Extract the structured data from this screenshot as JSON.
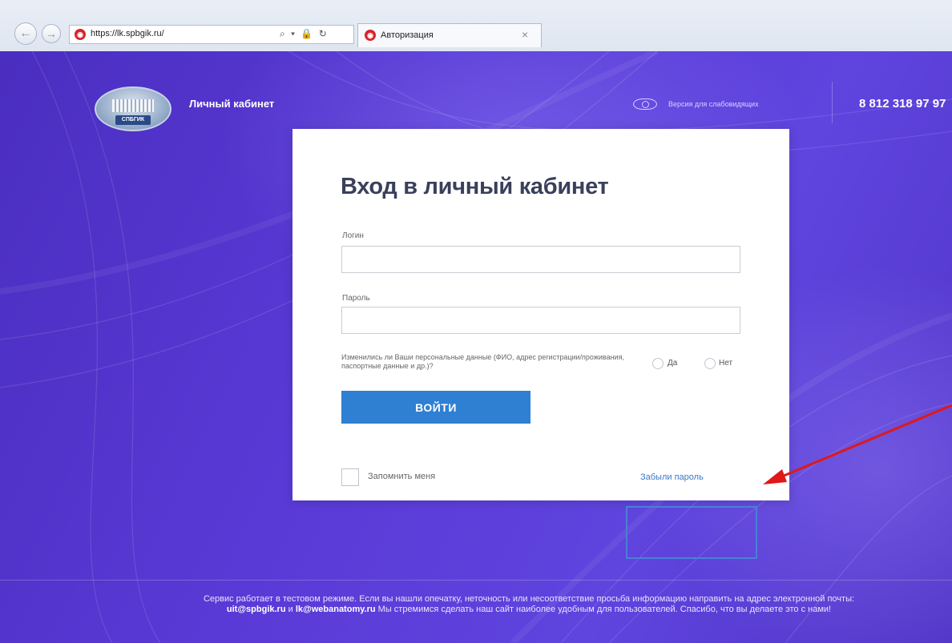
{
  "browser": {
    "url": "https://lk.spbgik.ru/",
    "address_icons": "⌕ ▾ 🔒 ↻",
    "tab_title": "Авторизация",
    "tab_close": "×",
    "back_glyph": "←",
    "forward_glyph": "→"
  },
  "header": {
    "logo_text": "СПБГИК",
    "site_title": "Личный кабинет",
    "vision_link": "Версия для слабовидящих",
    "phone": "8 812 318 97 97"
  },
  "login": {
    "title": "Вход в личный кабинет",
    "login_label": "Логин",
    "login_value": "",
    "password_label": "Пароль",
    "password_value": "",
    "question": "Изменились ли Ваши персональные данные (ФИО, адрес регистрации/проживания, паспортные данные и др.)?",
    "option_yes": "Да",
    "option_no": "Нет",
    "submit": "ВОЙТИ",
    "remember": "Запомнить меня",
    "forgot": "Забыли пароль"
  },
  "footer": {
    "text_1": "Сервис работает в тестовом режиме. Если вы нашли опечатку, неточность или несоответствие просьба информацию направить на адрес электронной почты: ",
    "email_1": "uit@spbgik.ru",
    "and": " и ",
    "email_2": "lk@webanatomy.ru",
    "text_2": " Мы стремимся сделать наш сайт наиболее удобным для пользователей. Спасибо, что вы делаете это с нами!"
  },
  "colors": {
    "page_bg": "#5a3ad6",
    "button": "#2f7fd3",
    "link": "#3a78c8",
    "annotation_box": "#4a80d6",
    "annotation_arrow": "#e01818"
  }
}
